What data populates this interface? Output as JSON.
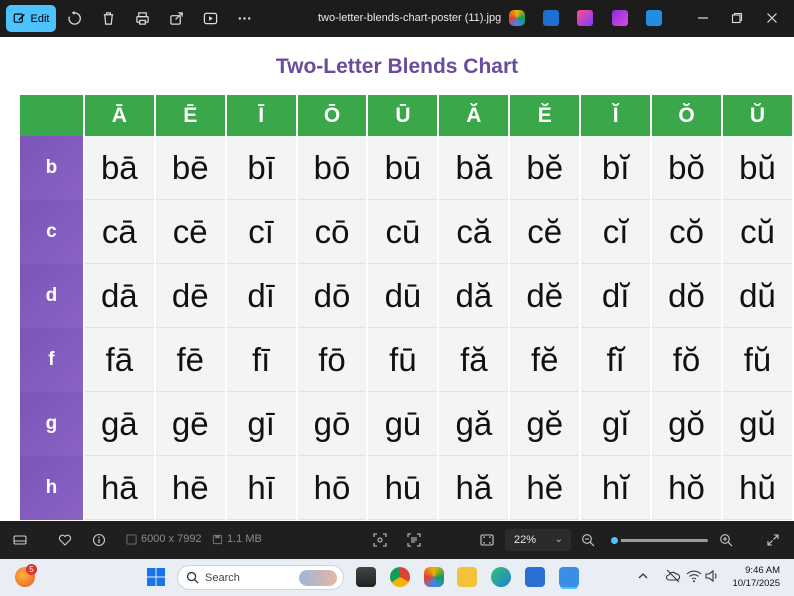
{
  "toolbar": {
    "edit_label": "Edit",
    "file_title": "two-letter-blends-chart-poster (11).jpg"
  },
  "chart": {
    "title": "Two-Letter Blends Chart",
    "vowels": [
      "Ā",
      "Ē",
      "Ī",
      "Ō",
      "Ū",
      "Ă",
      "Ĕ",
      "Ĭ",
      "Ŏ",
      "Ŭ"
    ],
    "rows": [
      {
        "consonant": "b",
        "blends": [
          "bā",
          "bē",
          "bī",
          "bō",
          "bū",
          "bă",
          "bĕ",
          "bĭ",
          "bŏ",
          "bŭ"
        ]
      },
      {
        "consonant": "c",
        "blends": [
          "cā",
          "cē",
          "cī",
          "cō",
          "cū",
          "că",
          "cĕ",
          "cĭ",
          "cŏ",
          "cŭ"
        ]
      },
      {
        "consonant": "d",
        "blends": [
          "dā",
          "dē",
          "dī",
          "dō",
          "dū",
          "dă",
          "dĕ",
          "dĭ",
          "dŏ",
          "dŭ"
        ]
      },
      {
        "consonant": "f",
        "blends": [
          "fā",
          "fē",
          "fī",
          "fō",
          "fū",
          "fă",
          "fĕ",
          "fĭ",
          "fŏ",
          "fŭ"
        ]
      },
      {
        "consonant": "g",
        "blends": [
          "gā",
          "gē",
          "gī",
          "gō",
          "gū",
          "gă",
          "gĕ",
          "gĭ",
          "gŏ",
          "gŭ"
        ]
      },
      {
        "consonant": "h",
        "blends": [
          "hā",
          "hē",
          "hī",
          "hō",
          "hū",
          "hă",
          "hĕ",
          "hĭ",
          "hŏ",
          "hŭ"
        ]
      }
    ],
    "colors": {
      "header": "#3aa84a",
      "row_header": "#7a56b8",
      "title": "#6a4c9c"
    }
  },
  "status": {
    "dimensions": "6000 x 7992",
    "size": "1.1 MB",
    "zoom": "22%",
    "zoom_fraction": 0.02
  },
  "taskbar": {
    "search_placeholder": "Search",
    "notification_count": "5",
    "time": "9:46 AM",
    "date": "10/17/2025"
  }
}
